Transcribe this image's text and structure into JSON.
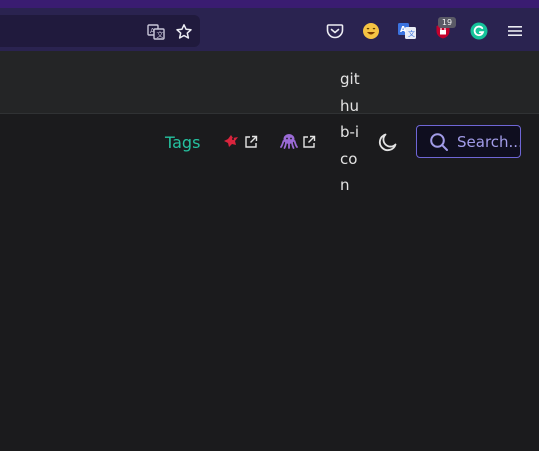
{
  "browser": {
    "toolbar_icons": {
      "translate": "translate-icon",
      "bookmark": "star-icon",
      "pocket": "pocket-icon",
      "emoji_ext": "emoji-icon",
      "translator_ext": "translator-icon",
      "adblock_ext": "ublock-icon",
      "grammarly_ext": "grammarly-icon",
      "menu": "hamburger-menu-icon"
    },
    "adblock_badge": "19",
    "colors": {
      "top_strip": "#3a1c71",
      "toolbar": "#2a2350",
      "urlbar": "#201a3d"
    }
  },
  "navbar": {
    "tags_label": "Tags",
    "github_icon_alt": "github-icon",
    "search_placeholder": "Search...",
    "accent": "#25c2a0",
    "colors": {
      "header_bg": "#242526",
      "page_bg": "#1b1b1d",
      "search_border": "#6f66d6",
      "search_text": "#a29ce8"
    }
  }
}
